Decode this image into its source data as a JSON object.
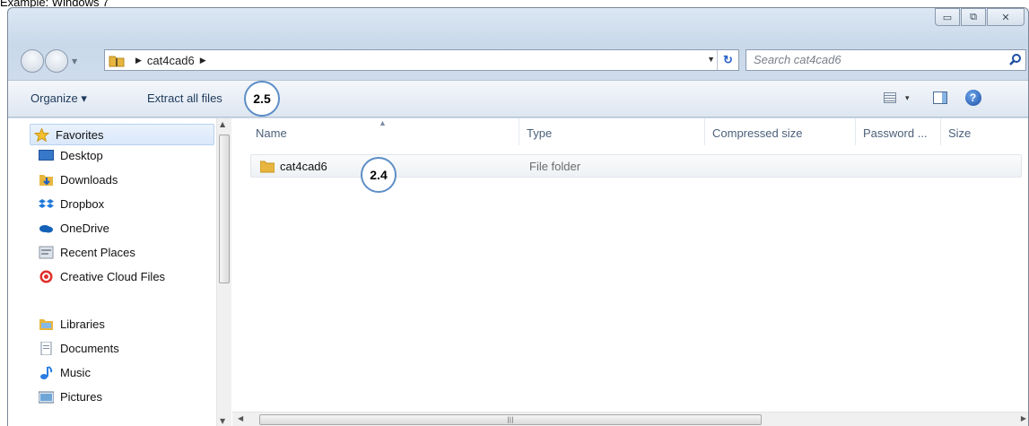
{
  "caption": "Example: Windows 7",
  "window": {
    "buttons": {
      "minimize": "▭",
      "maximize": "⧉",
      "close": "✕"
    }
  },
  "address": {
    "crumb": "cat4cad6",
    "search_placeholder": "Search cat4cad6"
  },
  "toolbar": {
    "organize": "Organize ▾",
    "extract": "Extract all files",
    "view_dd": "▾",
    "help": "?"
  },
  "annotations": {
    "extract_step": "2.5",
    "folder_step": "2.4"
  },
  "nav": {
    "favorites": "Favorites",
    "items": [
      "Desktop",
      "Downloads",
      "Dropbox",
      "OneDrive",
      "Recent Places",
      "Creative Cloud Files"
    ],
    "libraries": "Libraries",
    "library_items": [
      "Documents",
      "Music",
      "Pictures"
    ]
  },
  "columns": [
    "Name",
    "Type",
    "Compressed size",
    "Password ...",
    "Size"
  ],
  "files": [
    {
      "name": "cat4cad6",
      "type": "File folder"
    }
  ],
  "colors": {
    "accent": "#5d8ec6",
    "link": "#1e395b"
  }
}
